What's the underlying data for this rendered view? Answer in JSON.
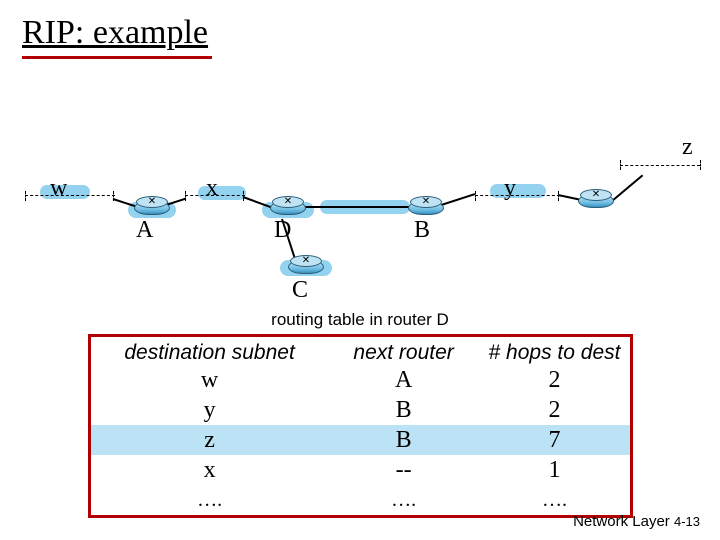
{
  "title": "RIP: example",
  "nets": {
    "w": "w",
    "x": "x",
    "y": "y",
    "z": "z"
  },
  "routers": {
    "A": "A",
    "D": "D",
    "B": "B",
    "C": "C"
  },
  "caption": "routing table in router D",
  "table": {
    "headers": {
      "dest": "destination subnet",
      "next": "next  router",
      "hops": "# hops to dest"
    },
    "rows": [
      {
        "dest": "w",
        "next": "A",
        "hops": "2"
      },
      {
        "dest": "y",
        "next": "B",
        "hops": "2"
      },
      {
        "dest": "z",
        "next": "B",
        "hops": "7"
      },
      {
        "dest": "x",
        "next": "--",
        "hops": "1"
      }
    ],
    "ellipsis": "…."
  },
  "footer": {
    "label": "Network Layer",
    "page": "4-13"
  }
}
